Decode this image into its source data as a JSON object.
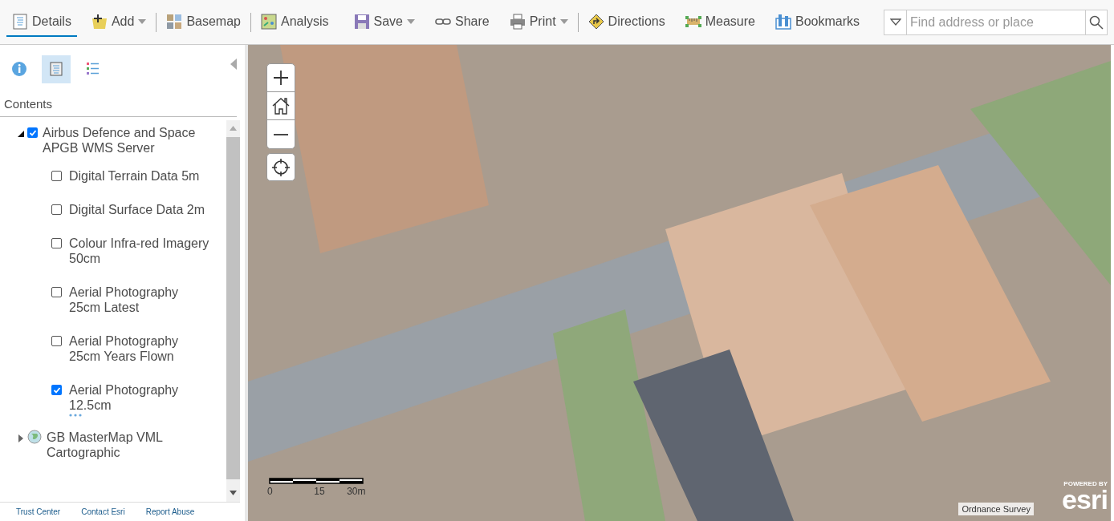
{
  "toolbar": {
    "left": [
      {
        "kind": "details",
        "label": "Details",
        "selected": true,
        "dropdown": false,
        "separator_after": false
      },
      {
        "kind": "add",
        "label": "Add",
        "selected": false,
        "dropdown": true,
        "separator_after": true
      },
      {
        "kind": "basemap",
        "label": "Basemap",
        "selected": false,
        "dropdown": false,
        "separator_after": true
      },
      {
        "kind": "analysis",
        "label": "Analysis",
        "selected": false,
        "dropdown": false,
        "separator_after": false
      }
    ],
    "right": [
      {
        "kind": "save",
        "label": "Save",
        "dropdown": true,
        "separator_after": false
      },
      {
        "kind": "share",
        "label": "Share",
        "dropdown": false,
        "separator_after": false
      },
      {
        "kind": "print",
        "label": "Print",
        "dropdown": true,
        "separator_after": true
      },
      {
        "kind": "directions",
        "label": "Directions",
        "dropdown": false,
        "separator_after": false
      },
      {
        "kind": "measure",
        "label": "Measure",
        "dropdown": false,
        "separator_after": false
      },
      {
        "kind": "bookmarks",
        "label": "Bookmarks",
        "dropdown": false,
        "separator_after": false
      }
    ],
    "search": {
      "placeholder": "Find address or place"
    }
  },
  "sidebar": {
    "tabs": [
      {
        "kind": "about",
        "selected": false
      },
      {
        "kind": "content",
        "selected": true
      },
      {
        "kind": "legend",
        "selected": false
      }
    ],
    "heading": "Contents",
    "layers": [
      {
        "label": "Airbus Defence and Space APGB WMS Server",
        "expanded": true,
        "checked": true,
        "kind": "checkbox",
        "children": [
          {
            "label": "Digital Terrain Data 5m",
            "checked": false,
            "more": false
          },
          {
            "label": "Digital Surface Data 2m",
            "checked": false,
            "more": false
          },
          {
            "label": "Colour Infra-red Imagery 50cm",
            "checked": false,
            "more": false
          },
          {
            "label": "Aerial Photography 25cm Latest",
            "checked": false,
            "more": false
          },
          {
            "label": "Aerial Photography 25cm Years Flown",
            "checked": false,
            "more": false
          },
          {
            "label": "Aerial Photography 12.5cm",
            "checked": true,
            "more": true
          }
        ]
      },
      {
        "label": "GB MasterMap VML Cartographic",
        "expanded": false,
        "kind": "globe"
      }
    ],
    "footer": [
      "Trust Center",
      "Contact Esri",
      "Report Abuse"
    ]
  },
  "map": {
    "scale_labels": [
      "0",
      "15",
      "30m"
    ],
    "attribution": "Ordnance Survey",
    "logo": {
      "small": "POWERED BY",
      "large": "esri"
    }
  }
}
